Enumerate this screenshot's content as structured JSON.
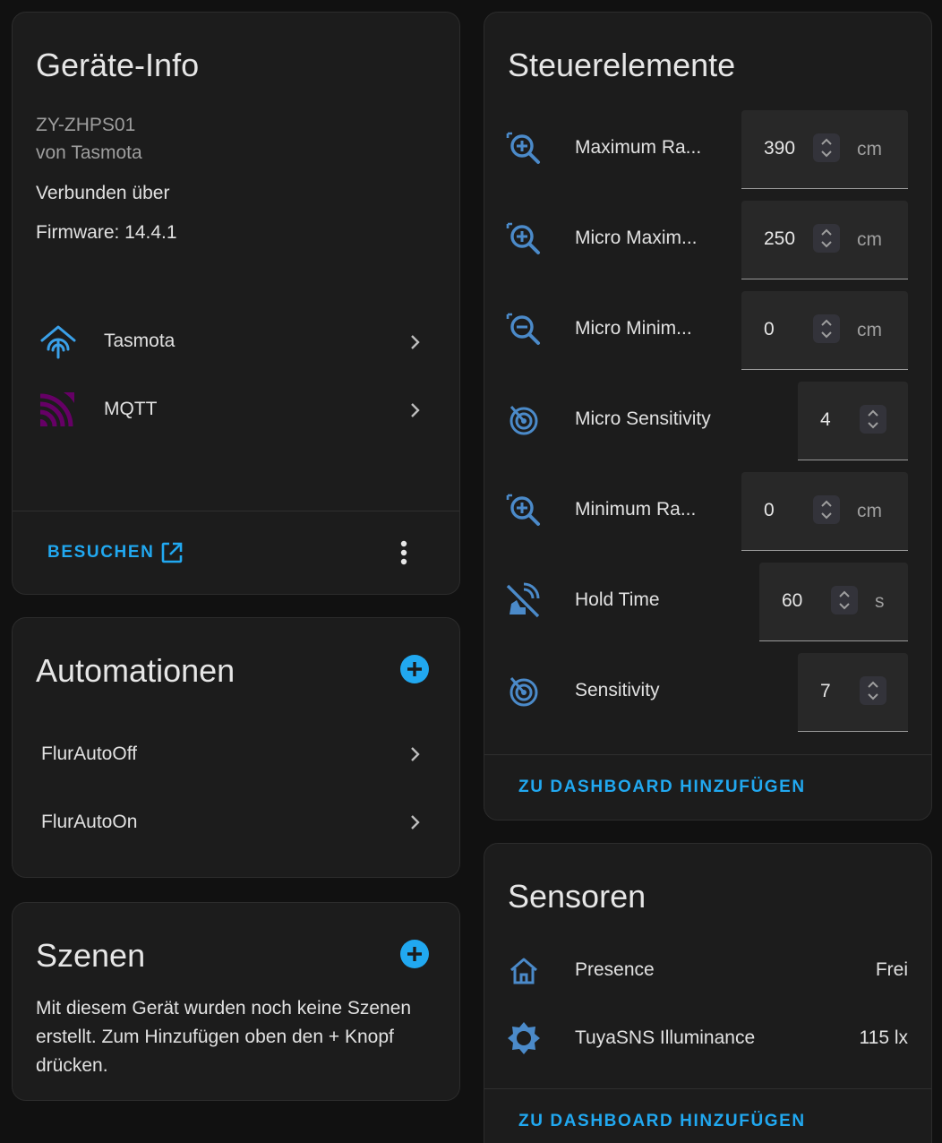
{
  "device_info": {
    "title": "Geräte-Info",
    "model": "ZY-ZHPS01",
    "manufacturer": "von Tasmota",
    "connected_via": "Verbunden über",
    "firmware": "Firmware: 14.4.1",
    "integrations": [
      {
        "label": "Tasmota",
        "icon": "tasmota-icon"
      },
      {
        "label": "MQTT",
        "icon": "mqtt-icon"
      }
    ],
    "visit_label": "BESUCHEN"
  },
  "automations": {
    "title": "Automationen",
    "items": [
      "FlurAutoOff",
      "FlurAutoOn"
    ]
  },
  "scenes": {
    "title": "Szenen",
    "empty_text_1": "Mit diesem Gerät wurden noch keine Szenen",
    "empty_text_2": "erstellt. Zum Hinzufügen oben den + Knopf",
    "empty_text_3": "drücken."
  },
  "controls": {
    "title": "Steuerelemente",
    "items": [
      {
        "label": "Maximum Ra...",
        "value": "390",
        "unit": "cm",
        "icon": "magnify-plus-icon"
      },
      {
        "label": "Micro Maxim...",
        "value": "250",
        "unit": "cm",
        "icon": "magnify-plus-icon"
      },
      {
        "label": "Micro Minim...",
        "value": "0",
        "unit": "cm",
        "icon": "magnify-minus-icon"
      },
      {
        "label": "Micro Sensitivity",
        "value": "4",
        "unit": "",
        "icon": "radar-icon"
      },
      {
        "label": "Minimum Ra...",
        "value": "0",
        "unit": "cm",
        "icon": "magnify-plus-icon"
      },
      {
        "label": "Hold Time",
        "value": "60",
        "unit": "s",
        "icon": "motion-sensor-off-icon"
      },
      {
        "label": "Sensitivity",
        "value": "7",
        "unit": "",
        "icon": "radar-icon"
      }
    ],
    "add_to_dashboard": "ZU DASHBOARD HINZUFÜGEN"
  },
  "sensors": {
    "title": "Sensoren",
    "items": [
      {
        "label": "Presence",
        "value": "Frei",
        "icon": "home-outline-icon"
      },
      {
        "label": "TuyaSNS Illuminance",
        "value": "115 lx",
        "icon": "brightness-icon"
      }
    ],
    "add_to_dashboard": "ZU DASHBOARD HINZUFÜGEN"
  },
  "colors": {
    "accent": "#21a8f0",
    "icon_blue": "#4b8ac9",
    "mqtt_purple": "#660066",
    "card_bg": "#1c1c1c",
    "page_bg": "#111111"
  }
}
